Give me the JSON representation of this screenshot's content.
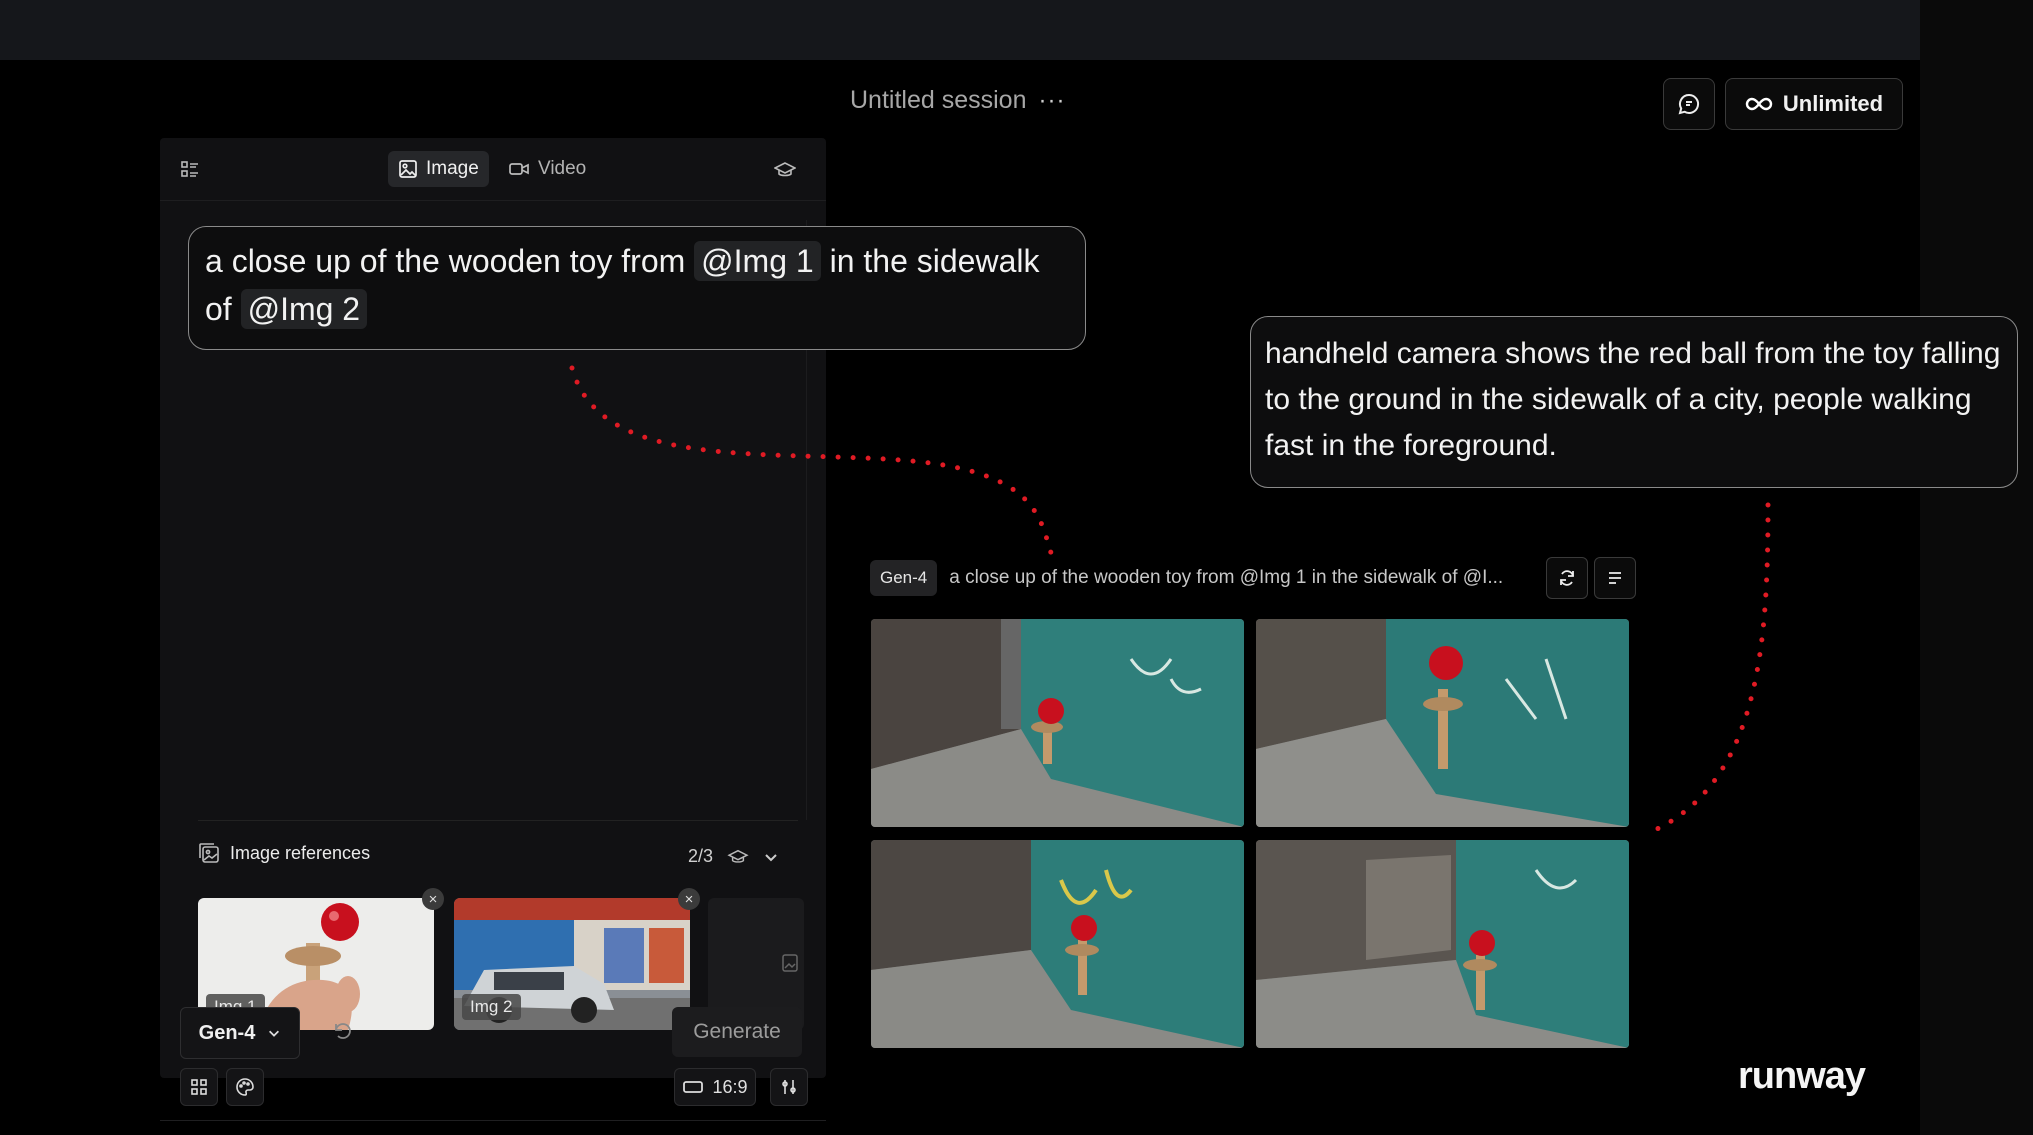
{
  "session": {
    "title": "Untitled session",
    "menu_glyph": "···"
  },
  "topright": {
    "chat_icon": "chat-icon",
    "plan_label": "Unlimited"
  },
  "panel": {
    "tabs": [
      {
        "label": "Image",
        "active": true
      },
      {
        "label": "Video",
        "active": false
      }
    ],
    "prompt": {
      "text_before": "a close up of the wooden toy from",
      "chip1": "@Img 1",
      "text_middle": "in the sidewalk of",
      "chip2": "@Img 2"
    },
    "references": {
      "label": "Image references",
      "count": "2/3",
      "items": [
        {
          "tag": "Img 1"
        },
        {
          "tag": "Img 2"
        }
      ]
    },
    "aspect_ratio": "16:9",
    "model": "Gen-4",
    "generate_label": "Generate"
  },
  "annotation": {
    "text": "handheld camera shows the red ball from the toy falling to the ground in the sidewalk of a city, people walking fast in the foreground."
  },
  "generation": {
    "model_badge": "Gen-4",
    "prompt_preview": "a close up of the wooden toy from @Img 1 in the sidewalk of @I..."
  },
  "brand": {
    "logo_text": "runway"
  },
  "colors": {
    "dotted_line": "#e01b24",
    "kendama_ball": "#c8101e",
    "wall": "#2f7f7b"
  }
}
